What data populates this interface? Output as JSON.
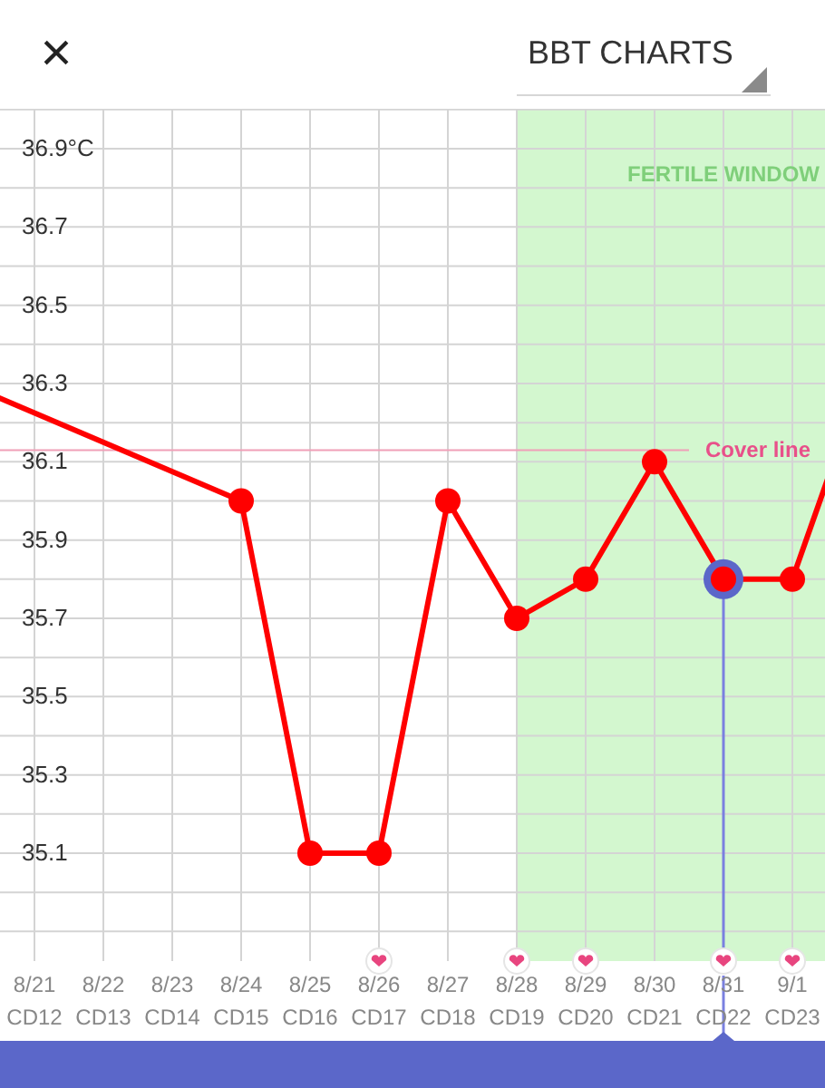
{
  "header": {
    "close": "×",
    "dropdown": "BBT CHARTS"
  },
  "chart": {
    "chart_data": {
      "type": "line",
      "categories": [
        null,
        "8/21",
        "8/22",
        "8/23",
        "8/24",
        "8/25",
        "8/26",
        "8/27",
        "8/28",
        "8/29",
        "8/30",
        "8/31",
        "9/1",
        null
      ],
      "series": [
        {
          "color": "#ff0000",
          "marker": "circle",
          "values": [
            36.3,
            null,
            null,
            null,
            36.0,
            35.1,
            35.1,
            36.0,
            35.7,
            35.8,
            36.1,
            35.8,
            35.8,
            36.3
          ]
        }
      ],
      "ylim": [
        34.5,
        37.28
      ],
      "grid": true,
      "yticks": [
        {
          "value": 36.9,
          "label": "36.9°C"
        },
        {
          "value": 36.7,
          "label": "36.7"
        },
        {
          "value": 36.5,
          "label": "36.5"
        },
        {
          "value": 36.3,
          "label": "36.3"
        },
        {
          "value": 36.1,
          "label": "36.1"
        },
        {
          "value": 35.9,
          "label": "35.9"
        },
        {
          "value": 35.7,
          "label": "35.7"
        },
        {
          "value": 35.5,
          "label": "35.5"
        },
        {
          "value": 35.3,
          "label": "35.3"
        },
        {
          "value": 35.1,
          "label": "35.1"
        }
      ],
      "ref_lines": [
        {
          "axis": "y",
          "value": 36.13,
          "label": "Cover line",
          "color": "#f0a0b8"
        }
      ]
    },
    "fertile_window_label": "FERTILE WINDOW",
    "days": [
      {
        "cycle_day": "CD12",
        "heart": false,
        "selected": false,
        "fertile": false
      },
      {
        "cycle_day": "CD13",
        "heart": false,
        "selected": false,
        "fertile": false
      },
      {
        "cycle_day": "CD14",
        "heart": false,
        "selected": false,
        "fertile": false
      },
      {
        "cycle_day": "CD15",
        "heart": false,
        "selected": false,
        "fertile": false
      },
      {
        "cycle_day": "CD16",
        "heart": false,
        "selected": false,
        "fertile": false
      },
      {
        "cycle_day": "CD17",
        "heart": true,
        "selected": false,
        "fertile": false
      },
      {
        "cycle_day": "CD18",
        "heart": false,
        "selected": false,
        "fertile": false
      },
      {
        "cycle_day": "CD19",
        "heart": true,
        "selected": false,
        "fertile": true
      },
      {
        "cycle_day": "CD20",
        "heart": true,
        "selected": false,
        "fertile": true
      },
      {
        "cycle_day": "CD21",
        "heart": false,
        "selected": false,
        "fertile": true
      },
      {
        "cycle_day": "CD22",
        "heart": true,
        "selected": true,
        "fertile": true
      },
      {
        "cycle_day": "CD23",
        "heart": true,
        "selected": false,
        "fertile": true
      }
    ]
  }
}
